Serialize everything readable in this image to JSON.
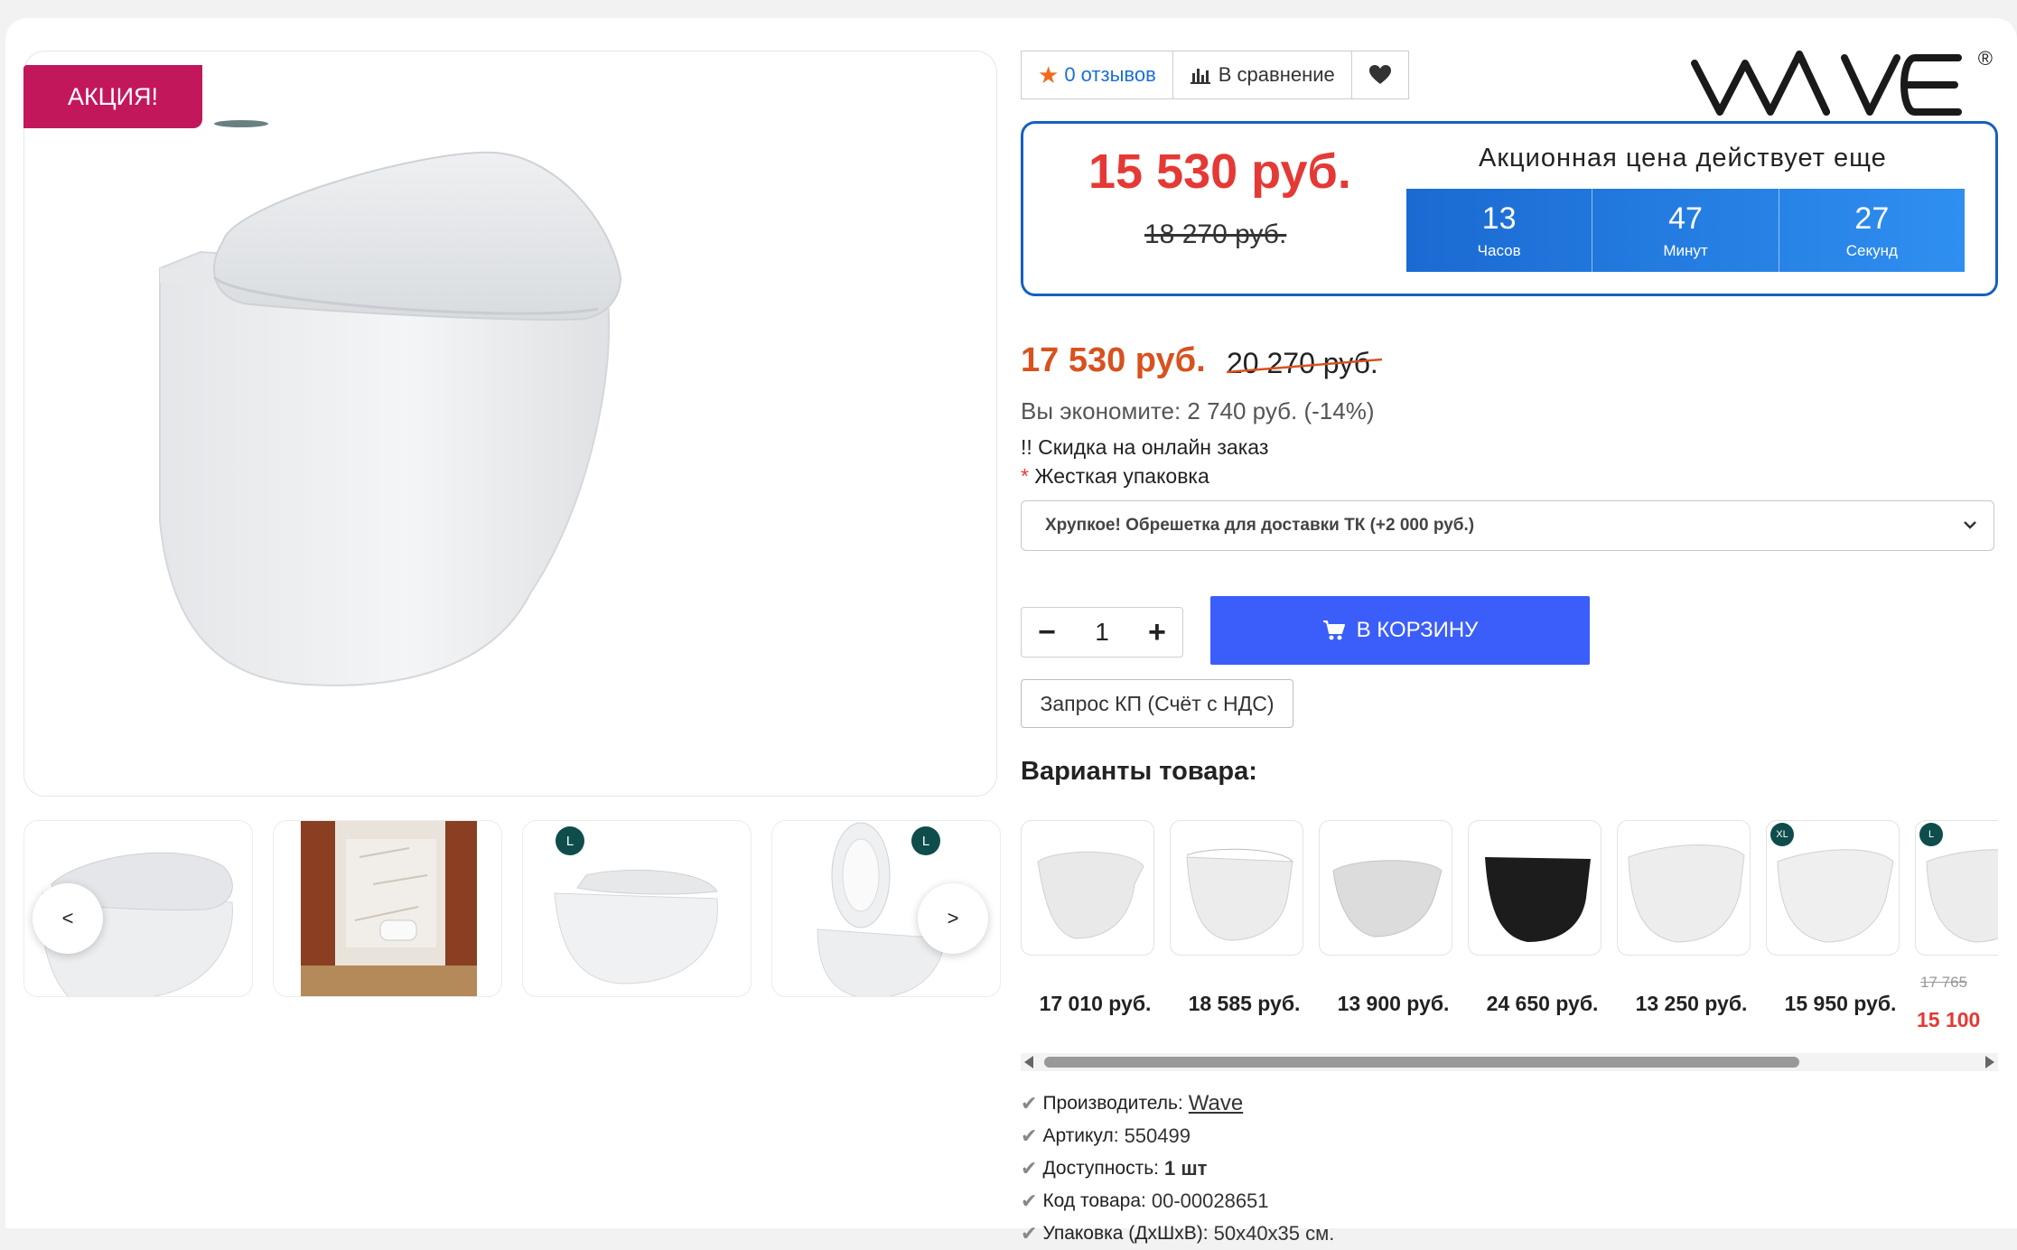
{
  "promo_badge": "АКЦИЯ!",
  "actions": {
    "reviews": "0 отзывов",
    "compare": "В сравнение"
  },
  "brand": {
    "name": "WAVE",
    "registered": "®"
  },
  "promo": {
    "price": "15 530 руб.",
    "old_price": "18 270 руб.",
    "title": "Акционная цена действует еще",
    "timer": [
      {
        "value": "13",
        "label": "Часов"
      },
      {
        "value": "47",
        "label": "Минут"
      },
      {
        "value": "27",
        "label": "Секунд"
      }
    ]
  },
  "price": {
    "current": "17 530 руб.",
    "old": "20 270 руб.",
    "savings": "Вы экономите: 2 740 руб. (-14%)",
    "note": "!! Скидка на онлайн заказ"
  },
  "packaging": {
    "asterisk": "*",
    "label": "Жесткая упаковка",
    "selected": "Хрупкое! Обрешетка для доставки ТК (+2 000 руб.)"
  },
  "quantity": {
    "minus": "−",
    "value": "1",
    "plus": "+"
  },
  "cart_button": "В КОРЗИНУ",
  "kp_button": "Запрос КП (Счёт с НДС)",
  "gallery": {
    "prev": "<",
    "next": ">",
    "badges": [
      "L",
      "L"
    ]
  },
  "variants": {
    "title": "Варианты товара:",
    "items": [
      {
        "price": "17 010 руб.",
        "color": "#e9e9e9"
      },
      {
        "price": "18 585 руб.",
        "color": "#ececec"
      },
      {
        "price": "13 900 руб.",
        "color": "#dcdcdc"
      },
      {
        "price": "24 650 руб.",
        "color": "#1c1c1c"
      },
      {
        "price": "13 250 руб.",
        "color": "#ededed"
      },
      {
        "price": "15 950 руб.",
        "color": "#efefef",
        "badge": "XL"
      },
      {
        "price_old": "17 765",
        "price": "15 100",
        "color": "#ececec",
        "badge": "L"
      }
    ]
  },
  "specs": [
    {
      "label": "Производитель:",
      "value": "Wave",
      "style": "link"
    },
    {
      "label": "Артикул:",
      "value": "550499",
      "style": "plain"
    },
    {
      "label": "Доступность:",
      "value": "1 шт",
      "style": "bold"
    },
    {
      "label": "Код товара:",
      "value": "00-00028651",
      "style": "plain"
    },
    {
      "label": "Упаковка (ДхШхВ):",
      "value": "50x40x35 см.",
      "style": "plain"
    }
  ],
  "colors": {
    "promo_red": "#e53935",
    "price_orange": "#d8521e",
    "cart_blue": "#3b5efa",
    "timer_blue": "#1a6ad2",
    "badge_magenta": "#c2185b"
  }
}
